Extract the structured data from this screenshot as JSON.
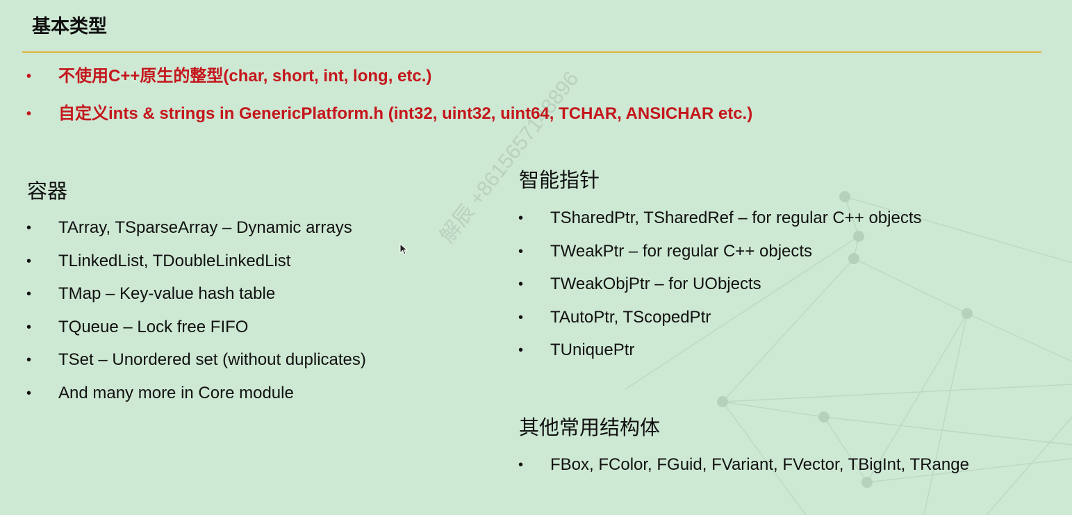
{
  "slide": {
    "title": "基本类型",
    "red_bullets": [
      "不使用C++原生的整型(char, short, int, long, etc.)",
      "自定义ints & strings in GenericPlatform.h (int32, uint32, uint64, TCHAR, ANSICHAR etc.)"
    ],
    "containers": {
      "title": "容器",
      "items": [
        "TArray, TSparseArray – Dynamic arrays",
        "TLinkedList, TDoubleLinkedList",
        "TMap – Key-value hash table",
        "TQueue – Lock free FIFO",
        "TSet – Unordered set (without duplicates)",
        "And many more in Core module"
      ]
    },
    "smart_pointers": {
      "title": "智能指针",
      "items": [
        "TSharedPtr, TSharedRef – for regular C++ objects",
        "TWeakPtr – for regular C++ objects",
        "TWeakObjPtr – for UObjects",
        "TAutoPtr, TScopedPtr",
        "TUniquePtr"
      ]
    },
    "other_structs": {
      "title": "其他常用结构体",
      "items": [
        "FBox, FColor, FGuid, FVariant, FVector, TBigInt, TRange"
      ]
    },
    "watermark": "解辰 +8615657148896",
    "bullet_glyph": "•"
  },
  "colors": {
    "background": "#cde8d3",
    "accent_red": "#c4161c",
    "rule": "#e2b13c",
    "text": "#111111"
  }
}
